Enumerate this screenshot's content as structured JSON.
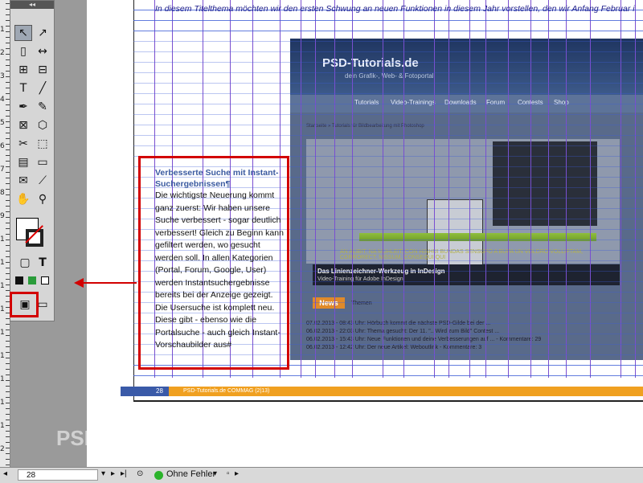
{
  "toolbox": {
    "header": "◂◂",
    "tools": [
      {
        "name": "selection-tool-icon",
        "glyph": "↖"
      },
      {
        "name": "direct-selection-tool-icon",
        "glyph": "↗"
      },
      {
        "name": "page-tool-icon",
        "glyph": "▯"
      },
      {
        "name": "gap-tool-icon",
        "glyph": "↔"
      },
      {
        "name": "content-collector-icon",
        "glyph": "⊞"
      },
      {
        "name": "content-placer-icon",
        "glyph": "⊟"
      },
      {
        "name": "type-tool-icon",
        "glyph": "T"
      },
      {
        "name": "line-tool-icon",
        "glyph": "╱"
      },
      {
        "name": "pen-tool-icon",
        "glyph": "✒"
      },
      {
        "name": "pencil-tool-icon",
        "glyph": "✎"
      },
      {
        "name": "rectangle-frame-tool-icon",
        "glyph": "⊠"
      },
      {
        "name": "polygon-tool-icon",
        "glyph": "⬡"
      },
      {
        "name": "scissors-tool-icon",
        "glyph": "✂"
      },
      {
        "name": "free-transform-tool-icon",
        "glyph": "⬚"
      },
      {
        "name": "gradient-swatch-tool-icon",
        "glyph": "▤"
      },
      {
        "name": "gradient-feather-tool-icon",
        "glyph": "▭"
      },
      {
        "name": "note-tool-icon",
        "glyph": "✉"
      },
      {
        "name": "eyedropper-tool-icon",
        "glyph": "⟋"
      },
      {
        "name": "hand-tool-icon",
        "glyph": "✋"
      },
      {
        "name": "zoom-tool-icon",
        "glyph": "⚲"
      }
    ],
    "format_text_label": "T",
    "view_mode_label": "▣"
  },
  "vruler": {
    "labels": [
      "1",
      "2",
      "3",
      "4",
      "5",
      "6",
      "7",
      "8",
      "9",
      "1",
      "1",
      "1",
      "1",
      "1",
      "1",
      "1",
      "1",
      "1",
      "2"
    ]
  },
  "document": {
    "top_line": "In diesem Titelthema möchten wir den ersten Schwung an neuen Funktionen in diesem Jahr vorstellen, den wir Anfang Februar i",
    "text_frame": {
      "heading": "Verbesserte Suche mit Instant-Suchergebnissen¶",
      "body": "Die wichtigste Neuerung kommt ganz zuerst: Wir haben unsere Suche verbessert - sogar deutlich verbessert! Gleich zu Beginn kann gefiltert werden, wo gesucht werden soll. In allen Kategorien (Portal, Forum, Google, User) werden Instantsuchergebnisse bereits bei der Anzeige gezeigt. Die Usersuche ist komplett neu. Diese gibt - ebenso wie die Portalsuche - auch gleich Instant-Vorschaubilder aus#"
    },
    "screenshot": {
      "logo": "PSD-Tutorials.de",
      "tagline": "dein Grafik-, Web- & Fotoportal",
      "nav": [
        "Tutorials",
        "Video-Trainings",
        "Downloads",
        "Forum",
        "Contests",
        "Shop"
      ],
      "breadcrumb": "Startseite » Tutorials für Bildbearbeitung mit Photoshop",
      "yellow_text": "AN ALIBIT, NA MUHLEIT, CON HINHUI BUNDAS SENSUPO A BUPA UN VOLDRO VOLLIPTAM, CORRORECT, NISSUM, CONSEQUI QUI",
      "caption_title": "Das Linienzeichner-Werkzeug in InDesign",
      "caption_sub": "Video-Training für Adobe InDesign",
      "news_label": "News",
      "news_tab": "Themen",
      "news_rows": [
        "07.02.2013 - 08:43 Uhr: Hörbuch kommt die nächste PSD-Gilde bei der ...",
        "06.02.2013 - 22:03 Uhr: Thema gesucht: Der 11. \"...Wird zum Bild\" Contest ...",
        "06.02.2013 - 15:43 Uhr: Neue Funktionen und deine Verbesserungen auf ... - Kommentare: 29",
        "06.02.2013 - 12:42 Uhr: Der neue Artikel: Weboutlink - Kommentare: 3"
      ]
    },
    "footer": {
      "page_number": "28",
      "footer_text": "PSD-Tutorials.de   COMMAG (2|13)"
    }
  },
  "watermark": "PSD-Tutorials.de",
  "statusbar": {
    "page_value": "28",
    "preflight_status": "Ohne Fehler"
  },
  "colors": {
    "annotation_red": "#d20000",
    "guide_purple": "#7a4fd0",
    "guide_blue": "#3b5bd6",
    "footer_orange": "#f0a020"
  }
}
